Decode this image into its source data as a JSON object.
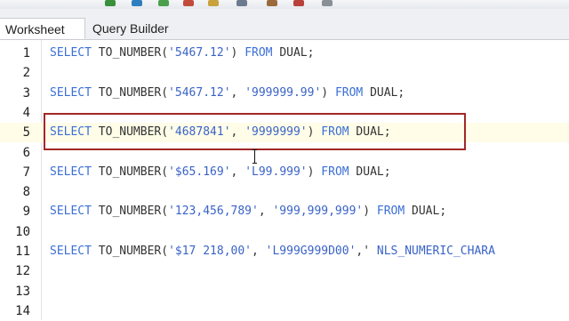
{
  "tabs": [
    {
      "label": "Worksheet",
      "active": true
    },
    {
      "label": "Query Builder",
      "active": false
    }
  ],
  "toolbar": {
    "icons": [
      "run-statement-icon",
      "run-script-icon",
      "commit-icon",
      "rollback-icon",
      "sql-tuning-icon",
      "explain-plan-icon",
      "autotrace-icon",
      "clear-icon",
      "history-icon"
    ]
  },
  "editor": {
    "lines": [
      {
        "num": "1",
        "tokens": [
          [
            "kw",
            "SELECT "
          ],
          [
            "plain",
            "TO_NUMBER("
          ],
          [
            "str",
            "'5467.12'"
          ],
          [
            "plain",
            ") "
          ],
          [
            "kw",
            "FROM"
          ],
          [
            "plain",
            " DUAL;"
          ]
        ]
      },
      {
        "num": "2",
        "tokens": []
      },
      {
        "num": "3",
        "tokens": [
          [
            "kw",
            "SELECT "
          ],
          [
            "plain",
            "TO_NUMBER("
          ],
          [
            "str",
            "'5467.12'"
          ],
          [
            "plain",
            ", "
          ],
          [
            "str",
            "'999999.99'"
          ],
          [
            "plain",
            ") "
          ],
          [
            "kw",
            "FROM"
          ],
          [
            "plain",
            " DUAL;"
          ]
        ]
      },
      {
        "num": "4",
        "tokens": []
      },
      {
        "num": "5",
        "tokens": [
          [
            "kw",
            "SELECT "
          ],
          [
            "plain",
            "TO_NUMBER("
          ],
          [
            "str",
            "'4687841'"
          ],
          [
            "plain",
            ", "
          ],
          [
            "str",
            "'9999999'"
          ],
          [
            "plain",
            ") "
          ],
          [
            "kw",
            "FROM"
          ],
          [
            "plain",
            " DUAL;"
          ]
        ]
      },
      {
        "num": "6",
        "tokens": []
      },
      {
        "num": "7",
        "tokens": [
          [
            "kw",
            "SELECT "
          ],
          [
            "plain",
            "TO_NUMBER("
          ],
          [
            "str",
            "'$65.169'"
          ],
          [
            "plain",
            ", "
          ],
          [
            "str",
            "'L99.999'"
          ],
          [
            "plain",
            ") "
          ],
          [
            "kw",
            "FROM"
          ],
          [
            "plain",
            " DUAL;"
          ]
        ]
      },
      {
        "num": "8",
        "tokens": []
      },
      {
        "num": "9",
        "tokens": [
          [
            "kw",
            "SELECT "
          ],
          [
            "plain",
            "TO_NUMBER("
          ],
          [
            "str",
            "'123,456,789'"
          ],
          [
            "plain",
            ", "
          ],
          [
            "str",
            "'999,999,999'"
          ],
          [
            "plain",
            ") "
          ],
          [
            "kw",
            "FROM"
          ],
          [
            "plain",
            " DUAL;"
          ]
        ]
      },
      {
        "num": "10",
        "tokens": []
      },
      {
        "num": "11",
        "tokens": [
          [
            "kw",
            "SELECT "
          ],
          [
            "plain",
            "TO_NUMBER("
          ],
          [
            "str",
            "'$17 218,00'"
          ],
          [
            "plain",
            ", "
          ],
          [
            "str",
            "'L999G999D00'"
          ],
          [
            "plain",
            ",' "
          ],
          [
            "str",
            "NLS_NUMERIC_CHARA"
          ]
        ]
      },
      {
        "num": "12",
        "tokens": []
      },
      {
        "num": "13",
        "tokens": []
      },
      {
        "num": "14",
        "tokens": []
      }
    ],
    "highlighted_line": 5
  },
  "colors": {
    "keyword": "#3b6fd6",
    "string": "#3a63c7",
    "selection_border": "#a32727"
  }
}
